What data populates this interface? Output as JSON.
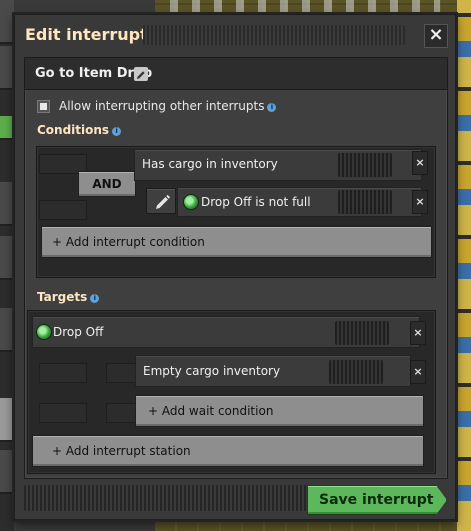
{
  "window": {
    "title": "Edit interrupt",
    "close_label": "×"
  },
  "interrupt": {
    "name": "Go to Item Drop",
    "allow_interrupting_label": "Allow interrupting other interrupts",
    "allow_interrupting_checked": false
  },
  "conditions": {
    "label": "Conditions",
    "logic": "AND",
    "items": [
      {
        "label": "Has cargo in inventory"
      },
      {
        "label": "Drop Off is not full"
      }
    ],
    "add_label": "+ Add interrupt condition"
  },
  "targets": {
    "label": "Targets",
    "station": "Drop Off",
    "wait_conditions": [
      {
        "label": "Empty cargo inventory"
      }
    ],
    "add_wait_label": "+ Add wait condition",
    "add_station_label": "+ Add interrupt station"
  },
  "footer": {
    "save_label": "Save interrupt"
  },
  "colors": {
    "title": "#ffe6c0",
    "confirm": "#5cb85a",
    "info": "#5fa0d8",
    "station_icon": "#3c9e3c"
  }
}
